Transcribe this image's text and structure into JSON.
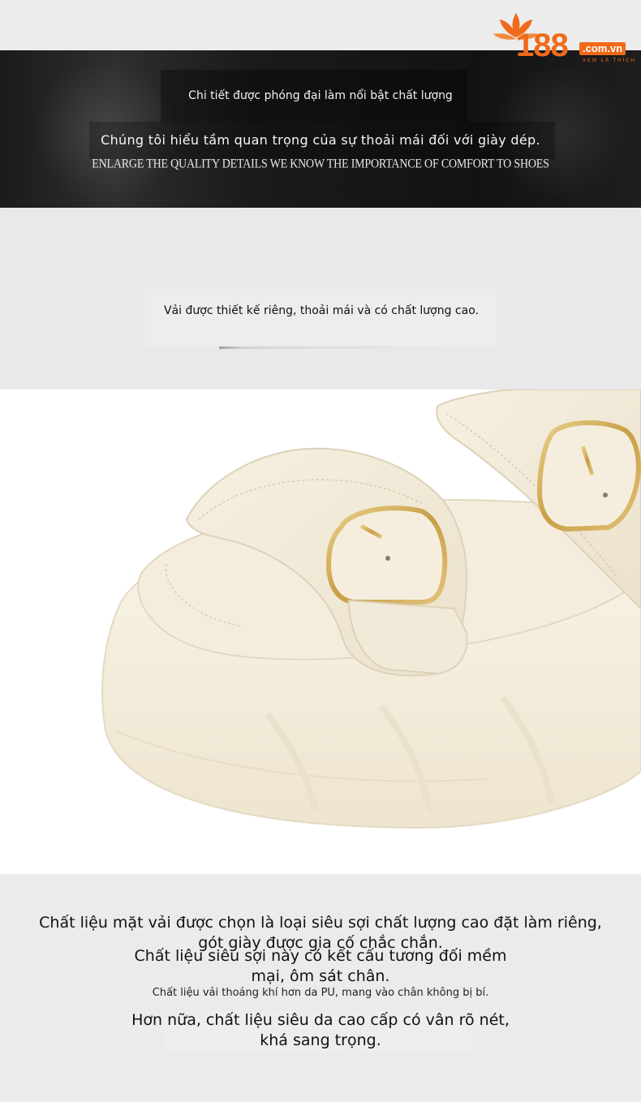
{
  "logo": {
    "number": "188",
    "domain": ".com.vn",
    "tagline": "XEM LÀ THÍCH",
    "brand_color": "#f06a1a",
    "icon": "lotus-flower-icon"
  },
  "banner": {
    "line1": "Chi tiết được phóng đại làm nổi bật chất lượng",
    "line2": "Chúng tôi hiểu tầm quan trọng của sự thoải mái đối với giày dép.",
    "line3": "ENLARGE THE QUALITY DETAILS WE KNOW THE IMPORTANCE OF COMFORT TO SHOES"
  },
  "caption": {
    "text": "Vải được thiết kế riêng, thoải mái và có chất lượng cao."
  },
  "product": {
    "image": "cream-platform-sandal-with-gold-buckles",
    "colors": {
      "leather": "#f3ecdc",
      "buckle": "#c9a24a"
    }
  },
  "description": {
    "p1": "Chất liệu mặt vải được chọn là loại siêu sợi chất lượng cao đặt làm riêng, gót giày được gia cố chắc chắn.",
    "p2": "Chất liệu siêu sợi này có kết cấu tương đối mềm mại, ôm sát chân.",
    "p3": "Chất liệu vải thoáng khí hơn da PU, mang vào chân không bị bí.",
    "p4": "Hơn nữa, chất liệu siêu da cao cấp có vân rõ nét, khá sang trọng."
  }
}
